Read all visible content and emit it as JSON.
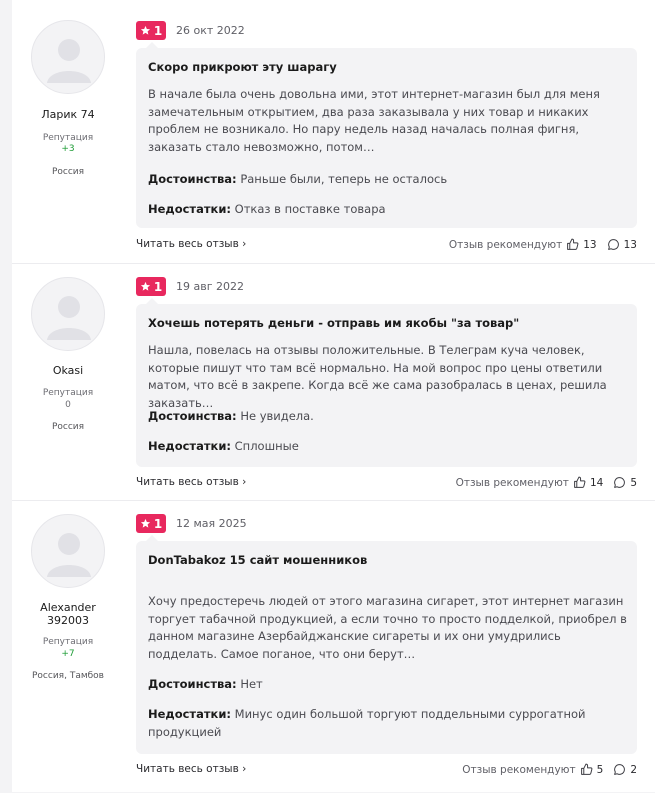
{
  "reviews": [
    {
      "author": "Ларик 74",
      "reputation_label": "Репутация",
      "reputation": "+3",
      "location": "Россия",
      "rating": "1",
      "date": "26 окт 2022",
      "title": "Скоро прикроют эту шарагу",
      "text": "В начале была очень довольна ими, этот интернет-магазин был для меня замечательным открытием, два раза заказывала у них товар и никаких проблем не возникало. Но пару недель назад началась полная фигня, заказать стало невозможно, потом…",
      "pros_label": "Достоинства:",
      "pros": "Раньше были, теперь не осталось",
      "cons_label": "Недостатки:",
      "cons": "Отказ в поставке товара",
      "read_all": "Читать весь отзыв",
      "recommend_label": "Отзыв рекомендуют",
      "likes": "13",
      "comments": "13"
    },
    {
      "author": "Okasi",
      "reputation_label": "Репутация",
      "reputation": "0",
      "location": "Россия",
      "rating": "1",
      "date": "19 авг 2022",
      "title": "Хочешь потерять деньги - отправь им якобы \"за товар\"",
      "text": "Нашла, повелась на отзывы положительные. В Телеграм куча человек, которые пишут что там всё нормально. На мой вопрос про цены ответили матом, что всё в закрепе. Когда всё же сама разобралась в ценах, решила заказать…",
      "pros_label": "Достоинства:",
      "pros": "Не увидела.",
      "cons_label": "Недостатки:",
      "cons": "Сплошные",
      "read_all": "Читать весь отзыв",
      "recommend_label": "Отзыв рекомендуют",
      "likes": "14",
      "comments": "5"
    },
    {
      "author": "Alexander 392003",
      "reputation_label": "Репутация",
      "reputation": "+7",
      "location": "Россия, Тамбов",
      "rating": "1",
      "date": "12 мая 2025",
      "title": "DonTabakoz 15 сайт мошенников",
      "text": "Хочу предостеречь людей от этого магазина сигарет, этот интернет магазин торгует табачной продукцией, а если точно то просто подделкой, приобрел в данном магазине Азербайджанские сигареты и их они умудрились подделать. Самое поганое, что они берут…",
      "pros_label": "Достоинства:",
      "pros": "Нет",
      "cons_label": "Недостатки:",
      "cons": "Минус один большой торгуют поддельными суррогатной продукцией",
      "read_all": "Читать весь отзыв",
      "recommend_label": "Отзыв рекомендуют",
      "likes": "5",
      "comments": "2"
    }
  ],
  "colors": {
    "rating_badge": "#e8285e",
    "positive_reputation": "#1e9c36",
    "bubble_bg": "#f3f3f5"
  },
  "icons": [
    "avatar-placeholder-icon",
    "star-icon",
    "chevron-right-icon",
    "thumbs-up-icon",
    "comment-icon"
  ]
}
